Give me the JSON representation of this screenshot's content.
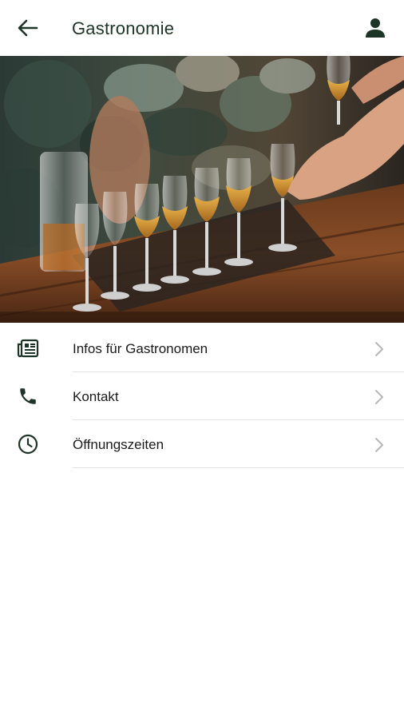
{
  "appbar": {
    "title": "Gastronomie",
    "back_icon": "arrow-left-icon",
    "account_icon": "person-icon"
  },
  "hero": {
    "image": "tasting-glasses-on-wooden-table"
  },
  "menu": {
    "items": [
      {
        "label": "Infos für Gastronomen",
        "icon": "newspaper-icon"
      },
      {
        "label": "Kontakt",
        "icon": "phone-icon"
      },
      {
        "label": "Öffnungszeiten",
        "icon": "clock-icon"
      }
    ]
  },
  "colors": {
    "accent": "#1d3527",
    "chevron": "#b8b8b8",
    "divider": "#e2e2e2"
  }
}
